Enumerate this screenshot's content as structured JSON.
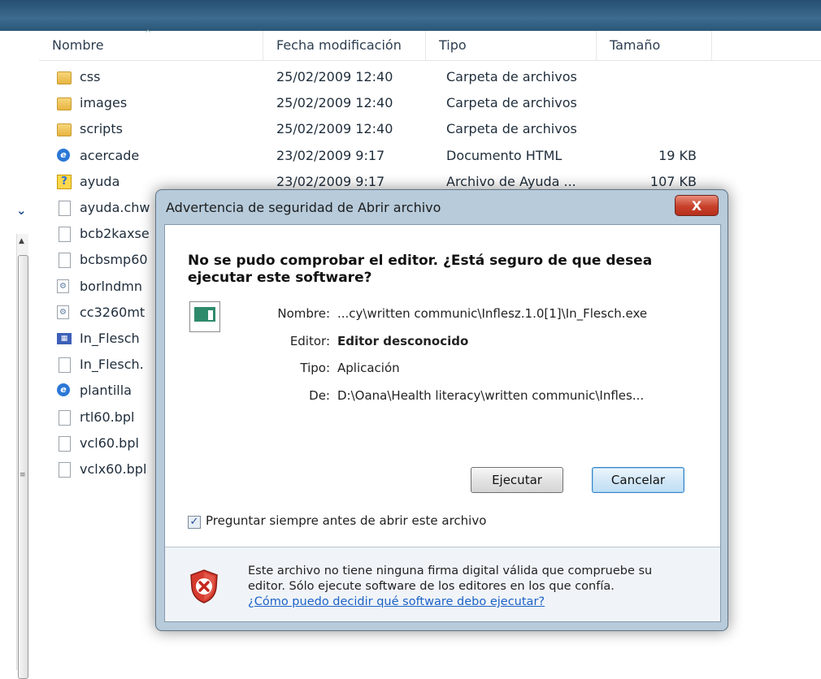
{
  "explorer": {
    "columns": [
      "Nombre",
      "Fecha modificación",
      "Tipo",
      "Tamaño"
    ],
    "files": [
      {
        "icon": "folder-icon",
        "name": "css",
        "date": "25/02/2009 12:40",
        "type": "Carpeta de archivos",
        "size": ""
      },
      {
        "icon": "folder-icon",
        "name": "images",
        "date": "25/02/2009 12:40",
        "type": "Carpeta de archivos",
        "size": ""
      },
      {
        "icon": "folder-icon",
        "name": "scripts",
        "date": "25/02/2009 12:40",
        "type": "Carpeta de archivos",
        "size": ""
      },
      {
        "icon": "html-file-icon",
        "name": "acercade",
        "date": "23/02/2009 9:17",
        "type": "Documento HTML",
        "size": "19 KB"
      },
      {
        "icon": "help-file-icon",
        "name": "ayuda",
        "date": "23/02/2009 9:17",
        "type": "Archivo de Ayuda ...",
        "size": "107 KB"
      },
      {
        "icon": "file-icon",
        "name": "ayuda.chw",
        "date": "",
        "type": "",
        "size": ""
      },
      {
        "icon": "file-icon",
        "name": "bcb2kaxse",
        "date": "",
        "type": "",
        "size": ""
      },
      {
        "icon": "file-icon",
        "name": "bcbsmp60",
        "date": "",
        "type": "",
        "size": ""
      },
      {
        "icon": "dll-file-icon",
        "name": "borlndmn",
        "date": "",
        "type": "",
        "size": ""
      },
      {
        "icon": "dll-file-icon",
        "name": "cc3260mt",
        "date": "",
        "type": "",
        "size": ""
      },
      {
        "icon": "exe-file-icon",
        "name": "In_Flesch",
        "date": "",
        "type": "",
        "size": ""
      },
      {
        "icon": "file-icon",
        "name": "In_Flesch.",
        "date": "",
        "type": "",
        "size": ""
      },
      {
        "icon": "html-file-icon",
        "name": "plantilla",
        "date": "",
        "type": "",
        "size": ""
      },
      {
        "icon": "file-icon",
        "name": "rtl60.bpl",
        "date": "",
        "type": "",
        "size": ""
      },
      {
        "icon": "file-icon",
        "name": "vcl60.bpl",
        "date": "",
        "type": "",
        "size": ""
      },
      {
        "icon": "file-icon",
        "name": "vclx60.bpl",
        "date": "",
        "type": "",
        "size": ""
      }
    ]
  },
  "dialog": {
    "title": "Advertencia de seguridad de Abrir archivo",
    "close_label": "X",
    "heading": "No se pudo comprobar el editor. ¿Está seguro de que desea ejecutar este software?",
    "fields": {
      "name_label": "Nombre:",
      "name_value": "...cy\\written communic\\Inflesz.1.0[1]\\In_Flesch.exe",
      "editor_label": "Editor:",
      "editor_value": "Editor desconocido",
      "type_label": "Tipo:",
      "type_value": "Aplicación",
      "from_label": "De:",
      "from_value": "D:\\Oana\\Health literacy\\written communic\\Infles..."
    },
    "run_label": "Ejecutar",
    "cancel_label": "Cancelar",
    "checkbox_label": "Preguntar siempre antes de abrir este archivo",
    "checkbox_checked": true,
    "warning_line1": "Este archivo no tiene ninguna firma digital válida que compruebe su",
    "warning_line2": "editor. Sólo ejecute software de los editores en los que confía.",
    "warning_link": "¿Cómo puedo decidir qué software debo ejecutar?"
  }
}
